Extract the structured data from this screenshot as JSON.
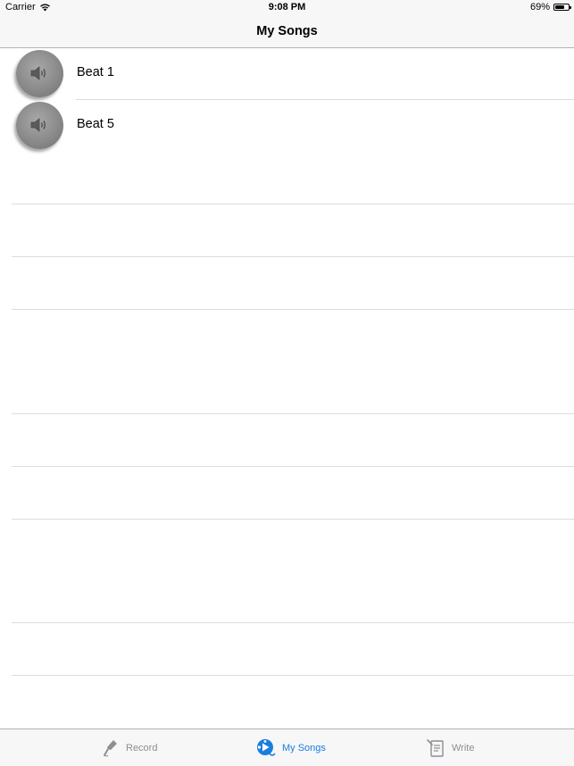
{
  "status_bar": {
    "carrier": "Carrier",
    "time": "9:08 PM",
    "battery_text": "69%",
    "battery_level": 0.69
  },
  "nav": {
    "title": "My Songs"
  },
  "songs": [
    {
      "label": "Beat 1",
      "icon": "speaker-icon"
    },
    {
      "label": "Beat 5",
      "icon": "speaker-icon"
    }
  ],
  "tabs": [
    {
      "label": "Record",
      "icon": "microphone-icon",
      "active": false
    },
    {
      "label": "My Songs",
      "icon": "songs-play-icon",
      "active": true
    },
    {
      "label": "Write",
      "icon": "notepad-icon",
      "active": false
    }
  ],
  "colors": {
    "active_tab": "#1a7ee0",
    "inactive_tab": "#8e8e93",
    "bar_background": "#f7f7f7"
  }
}
